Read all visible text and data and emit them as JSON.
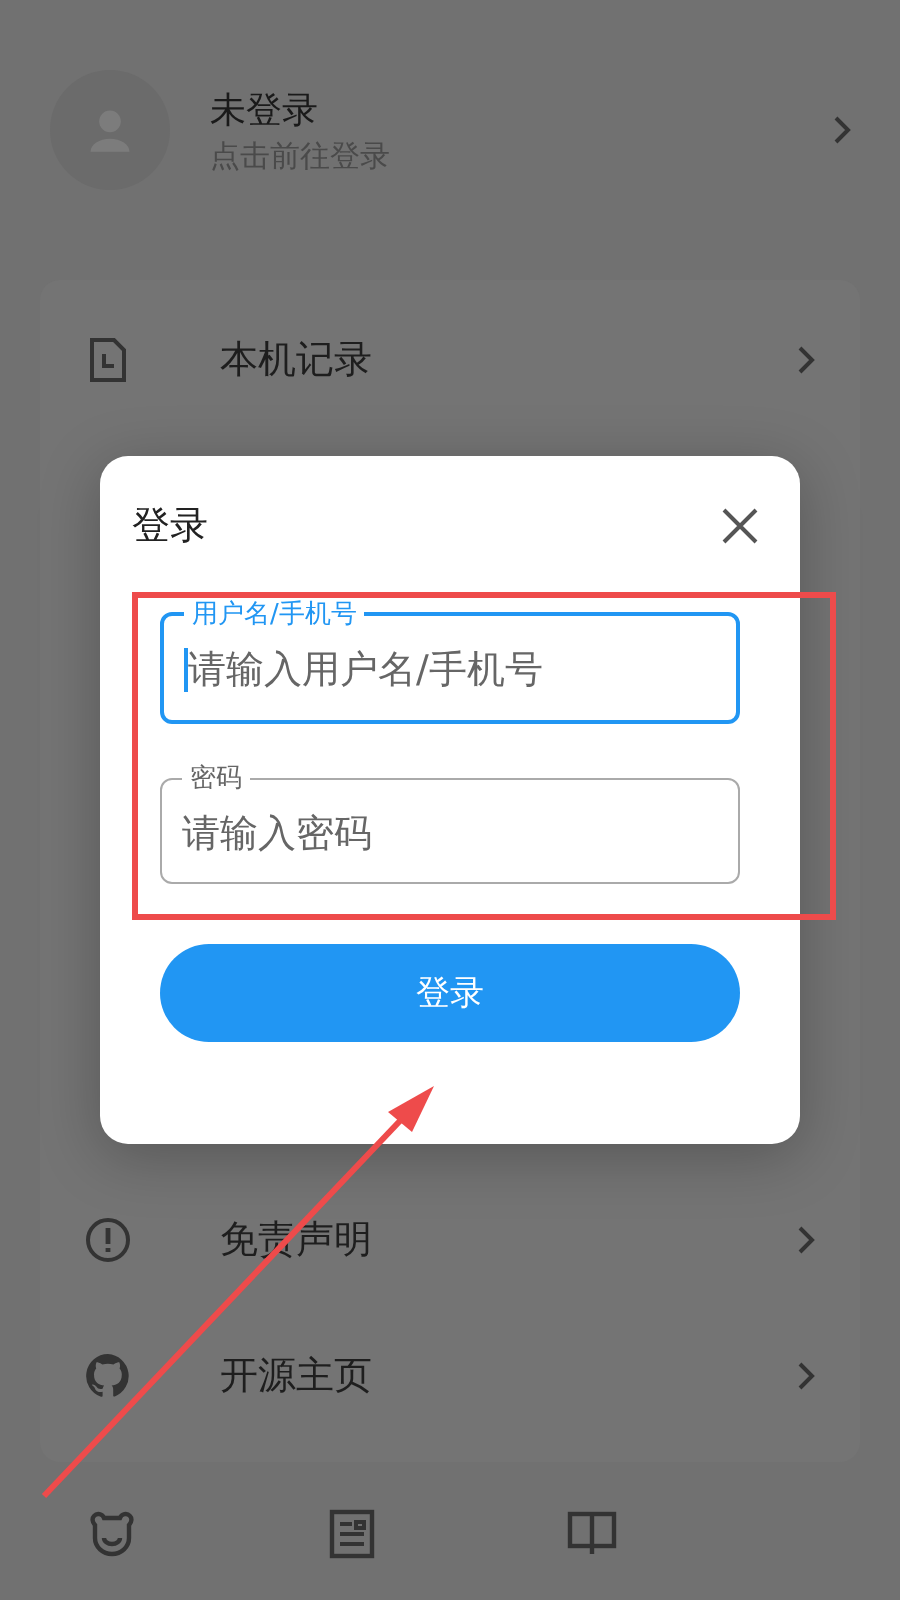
{
  "profile": {
    "name": "未登录",
    "hint": "点击前往登录"
  },
  "menu": [
    {
      "kind": "history",
      "label": "本机记录"
    },
    {
      "kind": "spacer"
    },
    {
      "kind": "info",
      "label": "免责声明"
    },
    {
      "kind": "github",
      "label": "开源主页"
    }
  ],
  "bottom_nav": [
    {
      "kind": "bear"
    },
    {
      "kind": "article"
    },
    {
      "kind": "book"
    }
  ],
  "dialog": {
    "title": "登录",
    "fields": [
      {
        "label": "用户名/手机号",
        "placeholder": "请输入用户名/手机号",
        "focused": true
      },
      {
        "label": "密码",
        "placeholder": "请输入密码",
        "focused": false
      }
    ],
    "button": "登录"
  }
}
